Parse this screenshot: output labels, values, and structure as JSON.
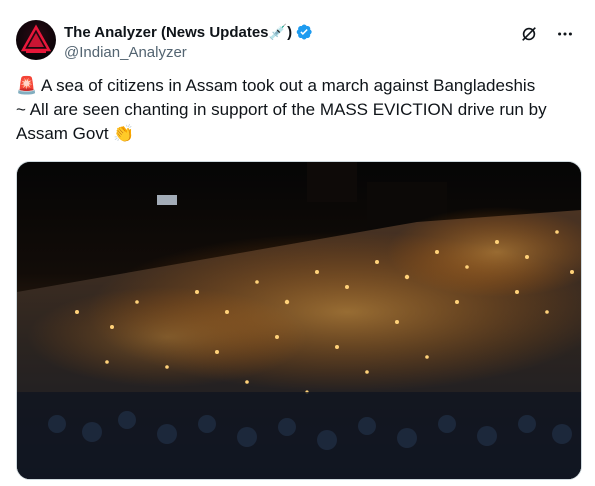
{
  "tweet": {
    "display_name": "The Analyzer (News Updates💉)",
    "handle": "@Indian_Analyzer",
    "verified": true,
    "avatar_icon": "analyzer-logo-icon",
    "text_emoji_start": "🚨",
    "text_line1": "A sea of citizens in Assam took out a march against Bangladeshis",
    "text_line2": "~ All are seen chanting in support of the MASS EVICTION drive run by",
    "text_line3": "Assam Govt",
    "text_emoji_end": "👏",
    "media_description_icon": "video-thumbnail-icon"
  },
  "actions": {
    "grok_icon": "grok-icon",
    "more_icon": "more-icon"
  },
  "colors": {
    "accent": "#1d9bf0",
    "text": "#0f1419",
    "secondary": "#536471"
  }
}
